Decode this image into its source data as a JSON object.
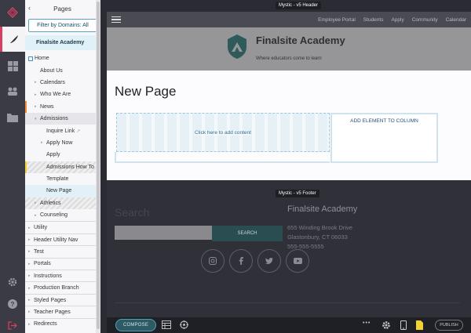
{
  "panel": {
    "title": "Pages",
    "back_icon": "chevron-left-icon",
    "filter_label": "Filter by Domains: All",
    "domain_label": "Finalsite Academy"
  },
  "tree": [
    {
      "label": "Home",
      "level": 0,
      "toggle": "",
      "type": "home"
    },
    {
      "label": "About Us",
      "level": 1,
      "toggle": ""
    },
    {
      "label": "Calendars",
      "level": 1,
      "toggle": "▸"
    },
    {
      "label": "Who We Are",
      "level": 1,
      "toggle": "▸"
    },
    {
      "label": "News",
      "level": 1,
      "toggle": "▸",
      "mark": "orange"
    },
    {
      "label": "Admissions",
      "level": 1,
      "toggle": "▾",
      "state": "active"
    },
    {
      "label": "Inquire Link",
      "level": 2,
      "toggle": "",
      "ext": true
    },
    {
      "label": "Apply Now",
      "level": 2,
      "toggle": "▸"
    },
    {
      "label": "Apply",
      "level": 2,
      "toggle": ""
    },
    {
      "label": "Admissions How To",
      "level": 2,
      "toggle": "",
      "state": "hatched",
      "mark": "yellow"
    },
    {
      "label": "Template",
      "level": 2,
      "toggle": ""
    },
    {
      "label": "New Page",
      "level": 2,
      "toggle": "",
      "state": "selected"
    },
    {
      "label": "Athletics",
      "level": 1,
      "toggle": "▸",
      "state": "hatched"
    },
    {
      "label": "Counseling",
      "level": 1,
      "toggle": "▸"
    },
    {
      "label": "Utility",
      "level": 0,
      "toggle": "▸",
      "sep": true
    },
    {
      "label": "Header Utility Nav",
      "level": 0,
      "toggle": "▸",
      "sep": true
    },
    {
      "label": "Test",
      "level": 0,
      "toggle": "▸",
      "sep": true
    },
    {
      "label": "Portals",
      "level": 0,
      "toggle": "▸",
      "sep": true
    },
    {
      "label": "Instructions",
      "level": 0,
      "toggle": "▸",
      "sep": true
    },
    {
      "label": "Production Branch",
      "level": 0,
      "toggle": "▸",
      "sep": true
    },
    {
      "label": "Styled Pages",
      "level": 0,
      "toggle": "▸",
      "sep": true
    },
    {
      "label": "Teacher Pages",
      "level": 0,
      "toggle": "▸",
      "sep": true
    },
    {
      "label": "Redirects",
      "level": 0,
      "toggle": "▸",
      "sep": true
    }
  ],
  "preview": {
    "header_tooltip": "Mystic - v5 Header",
    "footer_tooltip": "Mystic - v5 Footer",
    "nav_links": [
      "Employee Portal",
      "Students",
      "Apply",
      "Community",
      "Calendar"
    ],
    "school_name": "Finalsite Academy",
    "tagline": "Where educators come to learn",
    "page_title": "New Page",
    "add_content": "Click here to add content",
    "add_element": "ADD ELEMENT TO COLUMN",
    "search_title": "Search",
    "search_button": "SEARCH",
    "footer_school": "Finalsite Academy",
    "address_lines": [
      "655 Winding Brook Drive",
      "Glastonbury, CT 06033",
      "555-555-5555"
    ],
    "socials": [
      "instagram-icon",
      "facebook-icon",
      "twitter-icon",
      "youtube-icon"
    ]
  },
  "toolbar": {
    "compose": "COMPOSE",
    "publish": "PUBLISH",
    "more": "•••"
  },
  "colors": {
    "accent_pink": "#d63f5f",
    "teal": "#2e5a64",
    "brand_green": "#2f5a5a"
  }
}
